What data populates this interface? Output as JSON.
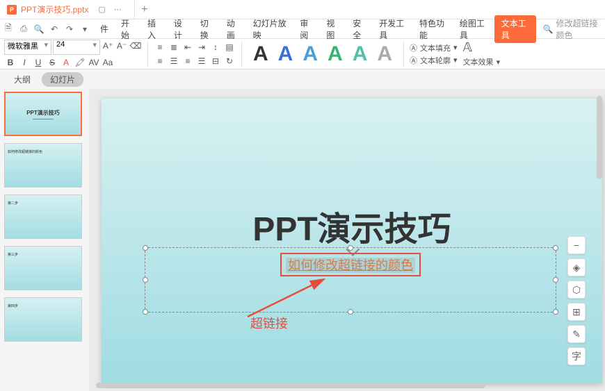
{
  "tab": {
    "title": "PPT演示技巧.pptx",
    "icon_letter": "P"
  },
  "menus": [
    "件",
    "开始",
    "插入",
    "设计",
    "切换",
    "动画",
    "幻灯片放映",
    "审阅",
    "视图",
    "安全",
    "开发工具",
    "特色功能",
    "绘图工具"
  ],
  "menu_active": "文本工具",
  "search_placeholder": "修改超链接颜色",
  "font": {
    "name": "微软雅黑",
    "size": "24"
  },
  "art_colors": [
    "#333333",
    "#3a6fd8",
    "#4a9fd8",
    "#3bb273",
    "#55c0a8",
    "#aaaaaa"
  ],
  "text_options": {
    "fill": "文本填充",
    "outline": "文本轮廓",
    "effect": "文本效果"
  },
  "panel_tabs": {
    "outline": "大纲",
    "slides": "幻灯片"
  },
  "slide": {
    "title": "PPT演示技巧",
    "hyperlink": "如何修改超链接的颜色",
    "annotation": "超链接"
  },
  "thumbs": [
    {
      "title": "PPT演示技巧",
      "sub": ""
    },
    {
      "small": "如何修改超链接的颜色"
    },
    {
      "small": "第二步"
    },
    {
      "small": "第三步"
    },
    {
      "small": "第四步"
    }
  ],
  "float_icons": [
    "minus",
    "layers",
    "reflect",
    "grid",
    "pencil",
    "text"
  ]
}
